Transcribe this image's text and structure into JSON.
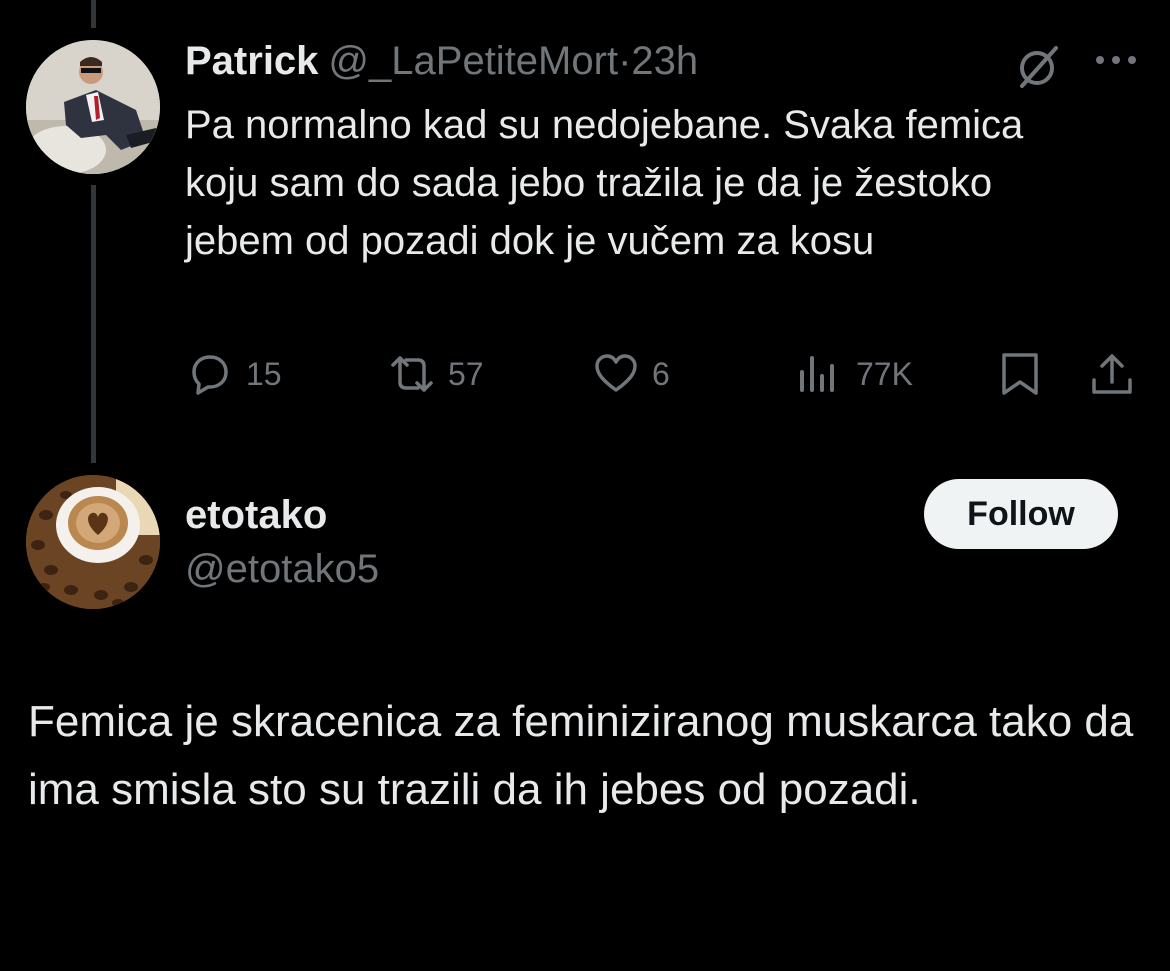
{
  "tweet": {
    "author_name": "Patrick",
    "author_handle": "@_LaPetiteMort",
    "separator": "·",
    "time": "23h",
    "text": "Pa normalno kad su nedojebane. Svaka femica koju sam do sada jebo tražila je da je žestoko jebem od pozadi dok je vučem za kosu",
    "stats": {
      "replies": "15",
      "retweets": "57",
      "likes": "6",
      "views": "77K"
    },
    "icons": {
      "grok": "grok-icon",
      "more": "more-icon",
      "reply": "reply-icon",
      "retweet": "retweet-icon",
      "like": "heart-icon",
      "views": "views-icon",
      "bookmark": "bookmark-icon",
      "share": "share-icon"
    }
  },
  "reply": {
    "author_name": "etotako",
    "author_handle": "@etotako5",
    "follow_label": "Follow",
    "text": "Femica je skracenica za feminiziranog muskarca tako da ima smisla sto su trazili da ih jebes od pozadi."
  },
  "colors": {
    "background": "#000000",
    "text_primary": "#e7e9ea",
    "text_secondary": "#71767b",
    "thread_line": "#333639",
    "follow_bg": "#eff3f4"
  }
}
